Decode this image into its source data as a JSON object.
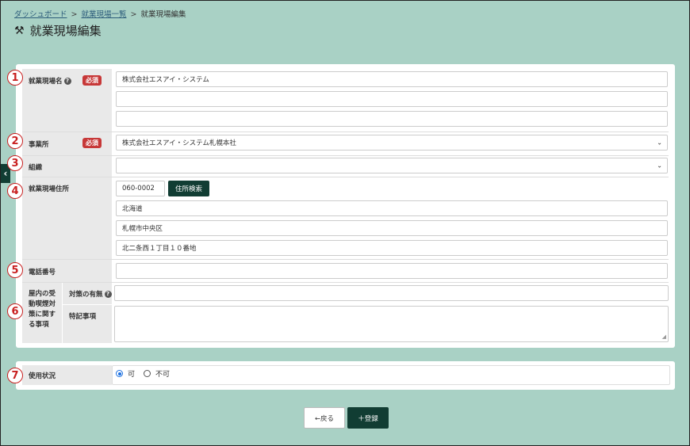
{
  "breadcrumb": {
    "items": [
      "ダッシュボード",
      "就業現場一覧",
      "就業現場編集"
    ],
    "sep": ">"
  },
  "page": {
    "title": "就業現場編集",
    "icon": "tools-icon"
  },
  "form": {
    "required_badge": "必須",
    "site_name": {
      "label": "就業現場名",
      "values": [
        "株式会社エスアイ・システム",
        "",
        ""
      ]
    },
    "office": {
      "label": "事業所",
      "value": "株式会社エスアイ・システム札幌本社"
    },
    "organization": {
      "label": "組織",
      "value": ""
    },
    "address": {
      "label": "就業現場住所",
      "zip": "060-0002",
      "search_button": "住所検索",
      "prefecture": "北海道",
      "city": "札幌市中央区",
      "street": "北二条西１丁目１０番地"
    },
    "phone": {
      "label": "電話番号",
      "value": ""
    },
    "smoking": {
      "label_lines": [
        "屋内の受",
        "動喫煙対",
        "策に関す",
        "る事項"
      ],
      "measures_label": "対策の有無",
      "measures_value": "",
      "notes_label": "特記事項",
      "notes_value": ""
    },
    "status": {
      "label": "使用状況",
      "options": [
        "可",
        "不可"
      ],
      "selected": "可"
    }
  },
  "actions": {
    "back": "←戻る",
    "register": "＋登録"
  },
  "annotations": [
    "1",
    "2",
    "3",
    "4",
    "5",
    "6",
    "7"
  ],
  "colors": {
    "background": "#a9d1c5",
    "primary": "#113d33",
    "required": "#c73838",
    "annotation": "#c82020"
  }
}
